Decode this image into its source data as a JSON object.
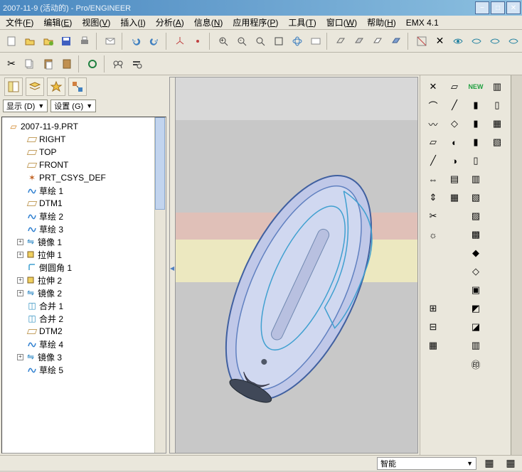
{
  "title": "2007-11-9 (活动的) - Pro/ENGINEER",
  "menus": [
    {
      "label": "文件",
      "key": "F"
    },
    {
      "label": "编辑",
      "key": "E"
    },
    {
      "label": "视图",
      "key": "V"
    },
    {
      "label": "插入",
      "key": "I"
    },
    {
      "label": "分析",
      "key": "A"
    },
    {
      "label": "信息",
      "key": "N"
    },
    {
      "label": "应用程序",
      "key": "P"
    },
    {
      "label": "工具",
      "key": "T"
    },
    {
      "label": "窗口",
      "key": "W"
    },
    {
      "label": "帮助",
      "key": "H"
    },
    {
      "label": "EMX 4.1",
      "key": ""
    }
  ],
  "dropdowns": {
    "display": "显示 (D)",
    "settings": "设置 (G)"
  },
  "tree": [
    {
      "icon": "part",
      "label": "2007-11-9.PRT",
      "level": 0
    },
    {
      "icon": "datum",
      "label": "RIGHT",
      "level": 1
    },
    {
      "icon": "datum",
      "label": "TOP",
      "level": 1
    },
    {
      "icon": "datum",
      "label": "FRONT",
      "level": 1
    },
    {
      "icon": "csys",
      "label": "PRT_CSYS_DEF",
      "level": 1
    },
    {
      "icon": "sketch",
      "label": "草绘 1",
      "level": 1
    },
    {
      "icon": "datum",
      "label": "DTM1",
      "level": 1
    },
    {
      "icon": "sketch",
      "label": "草绘 2",
      "level": 1
    },
    {
      "icon": "sketch",
      "label": "草绘 3",
      "level": 1
    },
    {
      "icon": "mirror",
      "label": "镜像 1",
      "level": 1,
      "exp": "+"
    },
    {
      "icon": "extrude",
      "label": "拉伸 1",
      "level": 1,
      "exp": "+"
    },
    {
      "icon": "round",
      "label": "倒圆角 1",
      "level": 1
    },
    {
      "icon": "extrude",
      "label": "拉伸 2",
      "level": 1,
      "exp": "+"
    },
    {
      "icon": "mirror",
      "label": "镜像 2",
      "level": 1,
      "exp": "+"
    },
    {
      "icon": "merge",
      "label": "合并 1",
      "level": 1
    },
    {
      "icon": "merge",
      "label": "合并 2",
      "level": 1
    },
    {
      "icon": "datum",
      "label": "DTM2",
      "level": 1
    },
    {
      "icon": "sketch",
      "label": "草绘 4",
      "level": 1
    },
    {
      "icon": "mirror",
      "label": "镜像 3",
      "level": 1,
      "exp": "+"
    },
    {
      "icon": "sketch",
      "label": "草绘 5",
      "level": 1
    }
  ],
  "status": {
    "mode": "智能"
  }
}
